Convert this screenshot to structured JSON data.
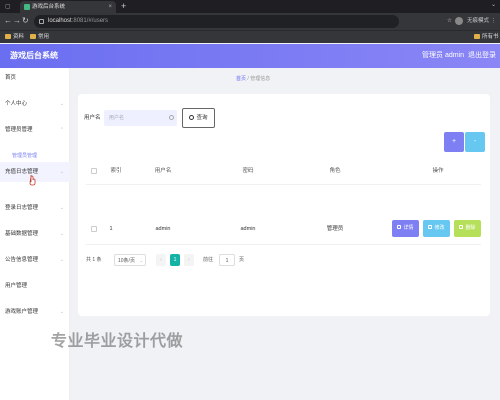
{
  "browser": {
    "tab_title": "游戏后台系统",
    "url_host": "localhost",
    "url_path": ":8081/#/users",
    "profile_label": "无痕模式",
    "bookmarks": [
      "资料",
      "常用"
    ],
    "bookmark_right": "所有书签"
  },
  "header": {
    "title": "游戏后台系统",
    "user": "管理员 admin",
    "logout": "退出登录"
  },
  "sidebar": {
    "items": [
      {
        "label": "首页",
        "arrow": false
      },
      {
        "label": "个人中心",
        "arrow": true
      },
      {
        "label": "管理员管理",
        "arrow": true
      },
      {
        "label": "充值日志管理",
        "arrow": true
      },
      {
        "label": "登录日志管理",
        "arrow": true
      },
      {
        "label": "基础数据管理",
        "arrow": true
      },
      {
        "label": "公告信息管理",
        "arrow": true
      },
      {
        "label": "用户管理",
        "arrow": false
      },
      {
        "label": "游戏账户管理",
        "arrow": true
      }
    ],
    "sub_item": "管理员管理"
  },
  "breadcrumb": {
    "home": "首页",
    "sep": "/",
    "current": "管理信息"
  },
  "search": {
    "label": "用户名",
    "placeholder": "用户名",
    "query_button": "查询"
  },
  "toolbar": {
    "add_icon": "+",
    "delete_icon": "-"
  },
  "table": {
    "columns": [
      "索引",
      "用户名",
      "密码",
      "角色",
      "操作"
    ],
    "rows": [
      {
        "index": "1",
        "username": "admin",
        "password": "admin",
        "role": "管理员"
      }
    ],
    "actions": {
      "detail": "详情",
      "edit": "修改",
      "delete": "删除"
    }
  },
  "pagination": {
    "total": "共 1 条",
    "page_size": "10条/页",
    "current_page": "1",
    "goto_label": "前往",
    "goto_value": "1",
    "page_suffix": "页"
  },
  "watermark": "专业毕业设计代做",
  "colors": {
    "header_start": "#6a6ef0",
    "header_end": "#8a86f6",
    "detail_btn": "#7d7ff3",
    "edit_btn": "#66c8f0",
    "delete_btn": "#b6e05a",
    "page_active": "#14b3a6"
  }
}
